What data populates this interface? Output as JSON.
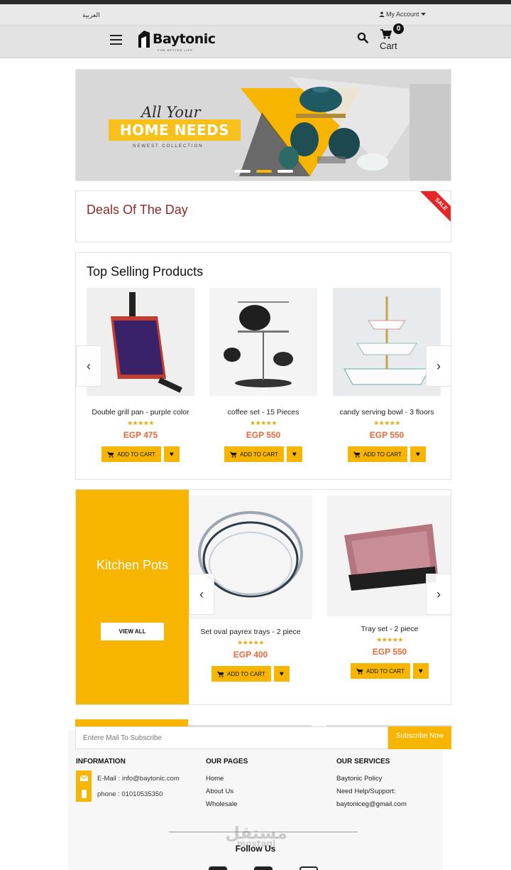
{
  "top_bar": {
    "language": "العربية",
    "my_account": "My Account"
  },
  "header": {
    "logo_word": "Baytonic",
    "logo_tagline": "FOR BETTER LIFE",
    "cart_count": "0",
    "cart_label": "Cart"
  },
  "banner": {
    "script": "All Your",
    "headline": "HOME NEEDS",
    "subline": "NEWEST COLLECTION",
    "slide_count": 3,
    "active_slide": 2
  },
  "deals": {
    "title": "Deals Of The Day",
    "ribbon": "SALE"
  },
  "top_selling": {
    "title": "Top Selling Products",
    "products": [
      {
        "name": "Double grill pan - purple color",
        "price": "EGP 475",
        "rating": 5,
        "add_label": "ADD TO CART"
      },
      {
        "name": "coffee set - 15 Pieces",
        "price": "EGP 550",
        "rating": 5,
        "add_label": "ADD TO CART"
      },
      {
        "name": "candy serving bowl - 3 floors",
        "price": "EGP 550",
        "rating": 5,
        "add_label": "ADD TO CART"
      }
    ]
  },
  "kitchen_pots": {
    "title": "Kitchen Pots",
    "view_all": "VIEW ALL",
    "products": [
      {
        "name": "Set oval payrex trays - 2 piece",
        "price": "EGP 400",
        "rating": 5,
        "add_label": "ADD TO CART"
      },
      {
        "name": "Tray set - 2 piece",
        "price": "EGP 550",
        "rating": 5,
        "add_label": "ADD TO CART"
      }
    ]
  },
  "subscribe": {
    "placeholder": "Entere Mail To Subscribe",
    "button": "Subscribe Now"
  },
  "footer": {
    "information": {
      "title": "INFORMATION",
      "email": "E-Mail : info@baytonic.com",
      "phone": "phone : 01010535350"
    },
    "pages": {
      "title": "OUR PAGES",
      "links": [
        "Home",
        "About Us",
        "Wholesale"
      ]
    },
    "services": {
      "title": "OUR SERVICES",
      "policy": "Baytonic Policy",
      "support": "Need Help/Support:",
      "support_email": "baytoniceg@gmail.com"
    },
    "follow_us": "Follow Us",
    "watermark": "مستقل",
    "watermark_sub": "mostaql"
  },
  "colors": {
    "accent": "#f7b500",
    "price": "#e46a3a",
    "deals_title": "#8b2a2a",
    "sale_ribbon": "#e62626"
  }
}
